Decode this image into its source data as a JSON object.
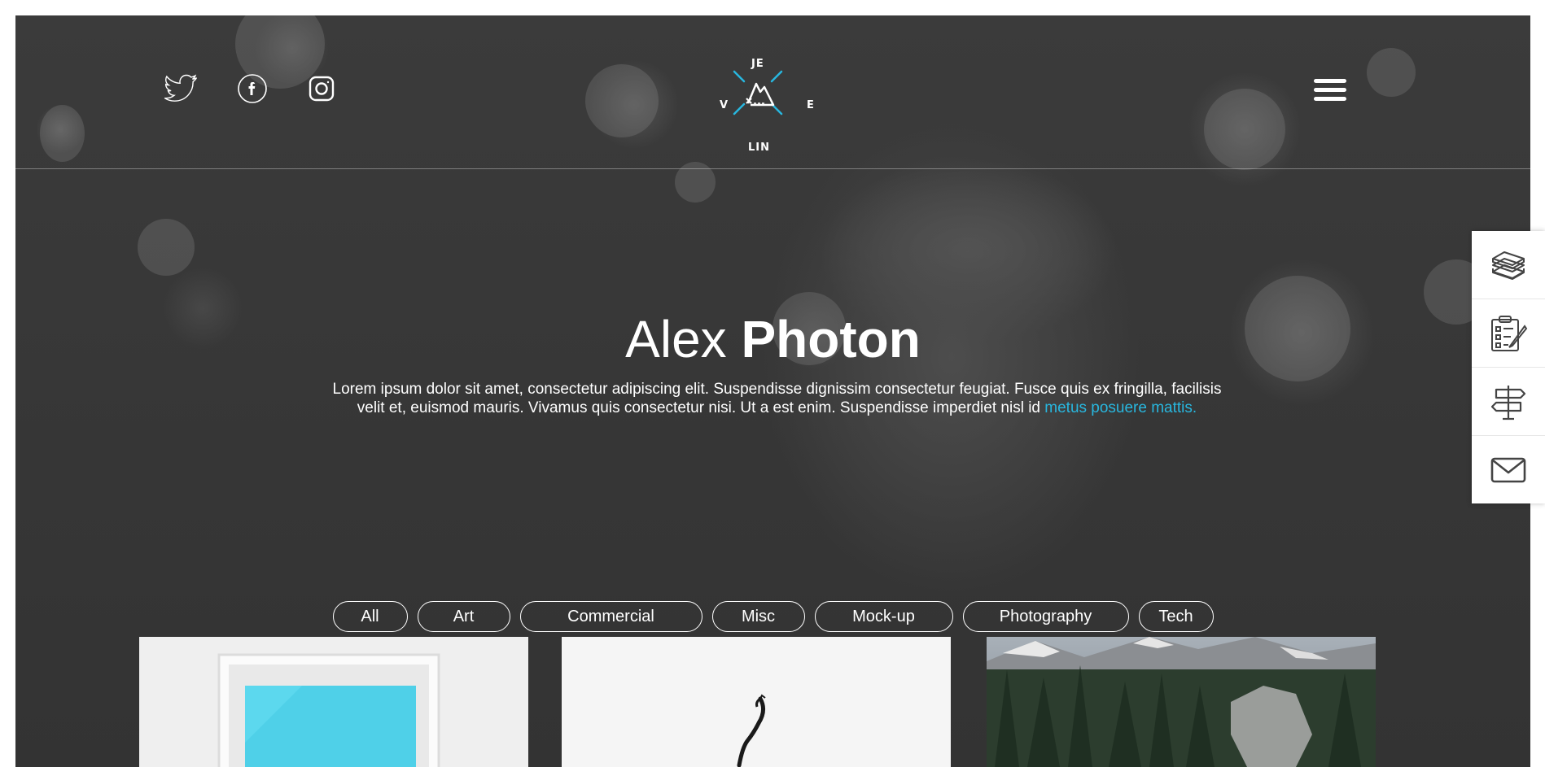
{
  "header": {
    "social": [
      {
        "name": "twitter-icon"
      },
      {
        "name": "facebook-icon"
      },
      {
        "name": "instagram-icon"
      }
    ],
    "logo": {
      "top": "JE",
      "left": "V",
      "right": "E",
      "bottom": "LIN"
    },
    "menu_icon": "hamburger-icon"
  },
  "hero": {
    "first_name": "Alex",
    "last_name": "Photon",
    "text": "Lorem ipsum dolor sit amet, consectetur adipiscing elit. Suspendisse dignissim consectetur feugiat. Fusce quis ex fringilla, facilisis velit et, euismod mauris. Vivamus quis consectetur nisi. Ut a est enim. Suspendisse imperdiet nisl id ",
    "link_text": "metus posuere mattis."
  },
  "filters": [
    {
      "label": "All"
    },
    {
      "label": "Art"
    },
    {
      "label": "Commercial"
    },
    {
      "label": "Misc"
    },
    {
      "label": "Mock-up"
    },
    {
      "label": "Photography"
    },
    {
      "label": "Tech"
    }
  ],
  "dock": [
    {
      "icon": "books-icon"
    },
    {
      "icon": "checklist-icon"
    },
    {
      "icon": "signpost-icon"
    },
    {
      "icon": "envelope-icon"
    }
  ],
  "colors": {
    "accent": "#28b7df",
    "background": "#3a3a3a"
  }
}
